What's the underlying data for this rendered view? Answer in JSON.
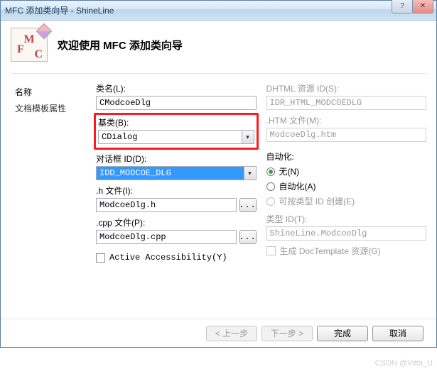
{
  "window": {
    "title": "MFC 添加类向导 - ShineLine"
  },
  "header": {
    "title": "欢迎使用 MFC 添加类向导"
  },
  "sidebar": {
    "items": [
      {
        "label": "名称",
        "active": true
      },
      {
        "label": "文档模板属性",
        "active": false
      }
    ]
  },
  "leftForm": {
    "classname_label": "类名(L):",
    "classname_value": "CModcoeDlg",
    "base_label": "基类(B):",
    "base_value": "CDialog",
    "dialogid_label": "对话框 ID(D):",
    "dialogid_value": "IDD_MODCOE_DLG",
    "hfile_label": ".h 文件(I):",
    "hfile_value": "ModcoeDlg.h",
    "cppfile_label": ".cpp 文件(P):",
    "cppfile_value": "ModcoeDlg.cpp",
    "active_acc_label": "Active Accessibility(Y)"
  },
  "rightForm": {
    "dhtml_label": "DHTML 资源 ID(S):",
    "dhtml_value": "IDR_HTML_MODCOEDLG",
    "htmfile_label": ".HTM 文件(M):",
    "htmfile_value": "ModcoeDlg.htm",
    "auto_group": "自动化:",
    "auto_none": "无(N)",
    "auto_auto": "自动化(A)",
    "auto_creatable": "可按类型 ID 创建(E)",
    "typeid_label": "类型 ID(T):",
    "typeid_value": "ShineLine.ModcoeDlg",
    "gendoc_label": "生成 DocTemplate 资源(G)"
  },
  "footer": {
    "prev": "< 上一步",
    "next": "下一步 >",
    "finish": "完成",
    "cancel": "取消"
  },
  "watermark": "CSDN @Vitta_U"
}
